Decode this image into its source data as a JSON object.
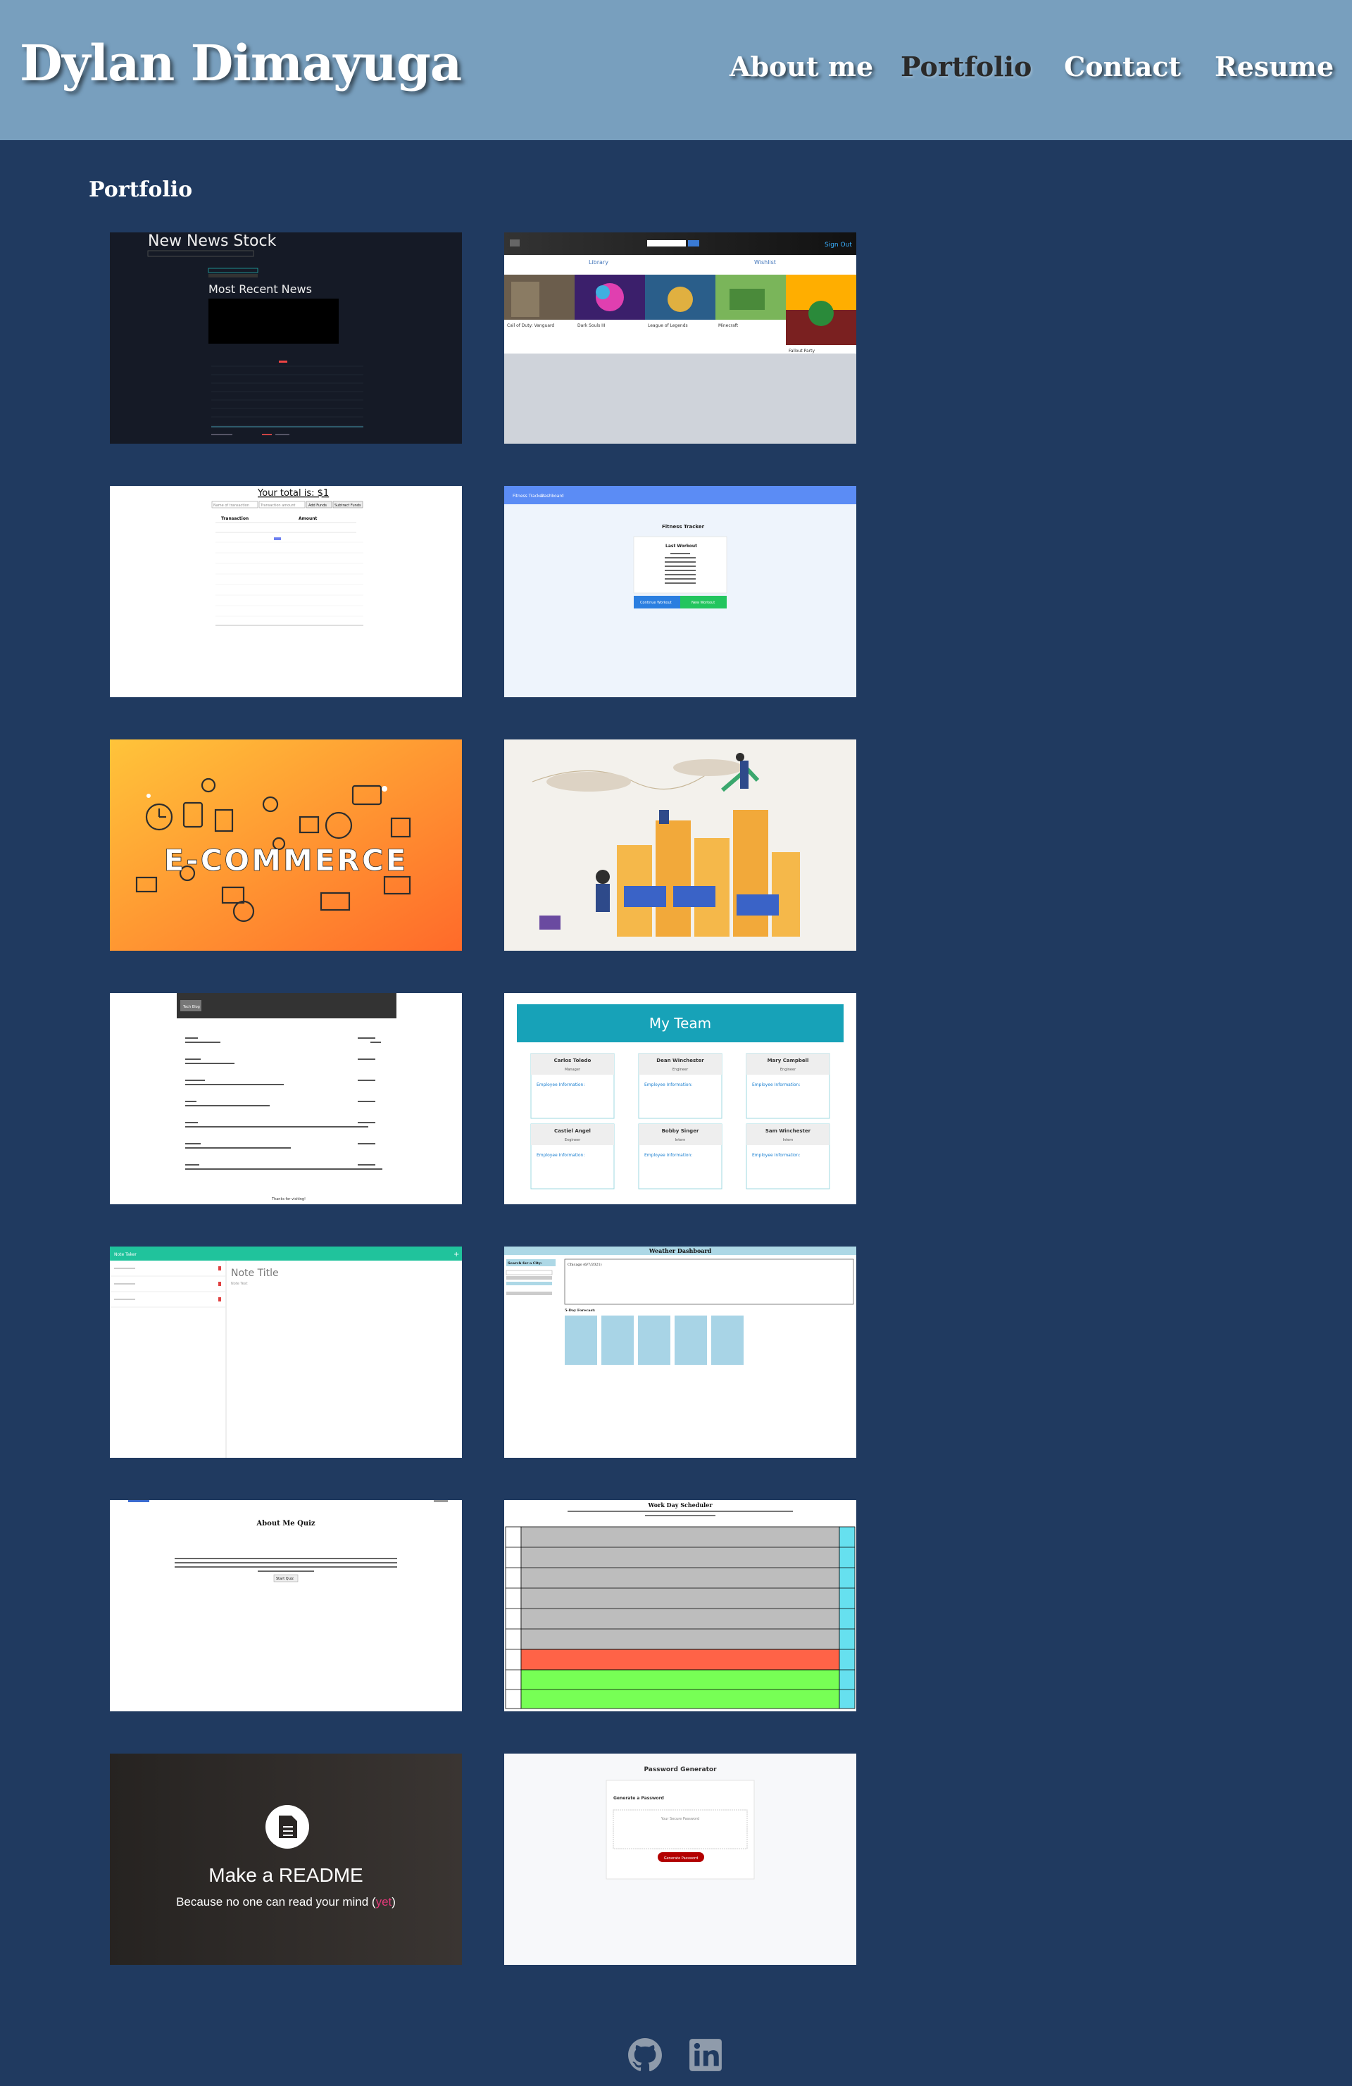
{
  "header": {
    "brand": "Dylan Dimayuga",
    "nav": [
      "About me",
      "Portfolio",
      "Contact",
      "Resume"
    ],
    "active": "Portfolio"
  },
  "portfolio": {
    "title": "Portfolio",
    "projects": {
      "news": {
        "title": "New News Stock",
        "subtitle": "Most Recent News"
      },
      "library": {
        "top_right": "Sign Out",
        "tabs": [
          "Library",
          "Wishlist"
        ],
        "games": [
          "Call of Duty: Vanguard",
          "Dark Souls III",
          "League of Legends",
          "Minecraft",
          "Fallout Party"
        ]
      },
      "budget": {
        "total": "Your total is: $1",
        "name_placeholder": "Name of transaction",
        "amount_placeholder": "Transaction amount",
        "add": "Add Funds",
        "subtract": "Subtract Funds",
        "col_transaction": "Transaction",
        "col_amount": "Amount"
      },
      "fitness": {
        "nav": [
          "Fitness Tracker",
          "Dashboard"
        ],
        "title": "Fitness Tracker",
        "card_title": "Last Workout",
        "continue": "Continue Workout",
        "new": "New Workout"
      },
      "ecommerce": {
        "word": "E-COMMERCE"
      },
      "tech_blog": {
        "nav": "Tech Blog",
        "footer": "Thanks for visiting!"
      },
      "team": {
        "title": "My Team",
        "members": [
          {
            "name": "Carlos Toledo",
            "role": "Manager"
          },
          {
            "name": "Dean Winchester",
            "role": "Engineer"
          },
          {
            "name": "Mary Campbell",
            "role": "Engineer"
          },
          {
            "name": "Castiel Angel",
            "role": "Engineer"
          },
          {
            "name": "Bobby Singer",
            "role": "Intern"
          },
          {
            "name": "Sam Winchester",
            "role": "Intern"
          }
        ],
        "info_label": "Employee Information:"
      },
      "note_taker": {
        "header": "Note Taker",
        "title": "Note Title",
        "text": "Note Text"
      },
      "weather": {
        "title": "Weather Dashboard",
        "search_label": "Search for a City:",
        "city": "Chicago (6/7/2021)",
        "forecast_label": "5-Day Forecast:"
      },
      "quiz": {
        "title": "About Me Quiz",
        "start": "Start Quiz"
      },
      "scheduler": {
        "title": "Work Day Scheduler"
      },
      "readme": {
        "title": "Make a README",
        "tagline": "Because no one can read your mind (",
        "tagline_em": "yet",
        "tagline_end": ")"
      },
      "password": {
        "title": "Password Generator",
        "card_title": "Generate a Password",
        "placeholder": "Your Secure Password",
        "button": "Generate Password"
      }
    }
  },
  "footer": {
    "icons": [
      "github-icon",
      "linkedin-icon"
    ]
  },
  "colors": {
    "header": "#789fbe",
    "page": "#203a60",
    "scheduler_present": "#ff6347",
    "scheduler_future": "#77dd77"
  }
}
